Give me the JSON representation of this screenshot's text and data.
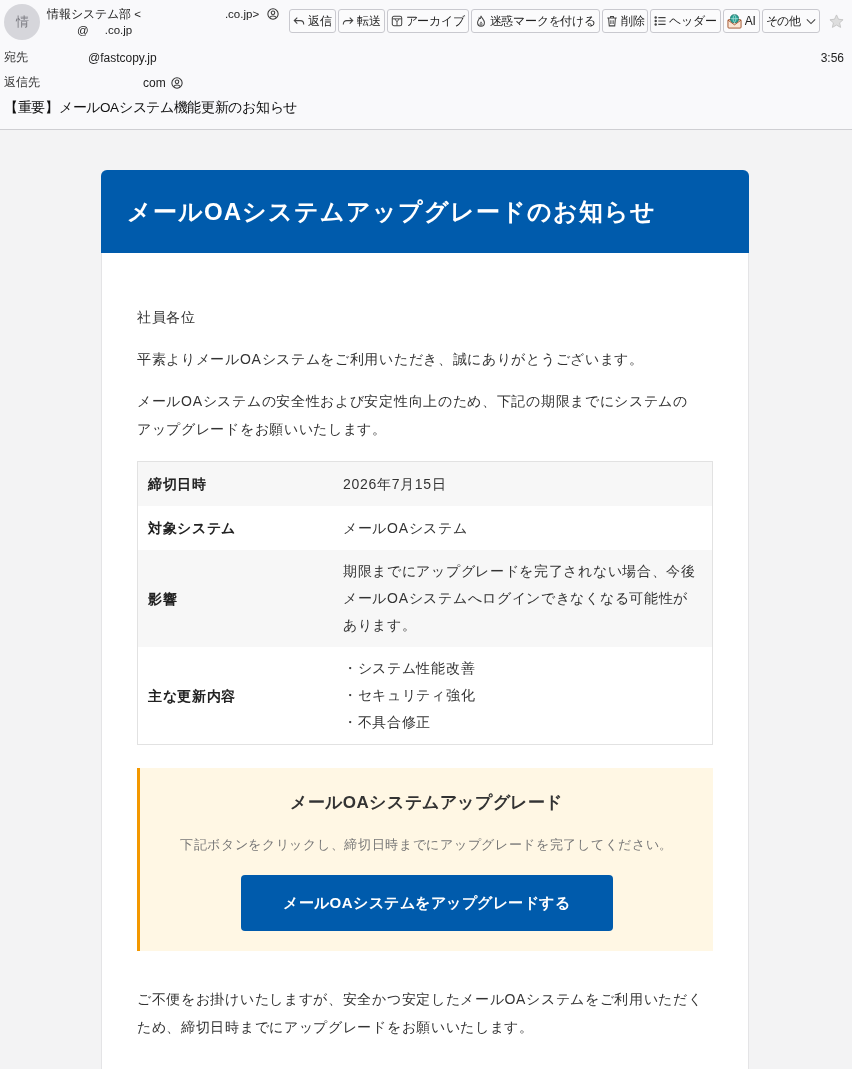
{
  "sender": {
    "avatar": "情",
    "name": "情報システム部 <",
    "address_end": ".co.jp>",
    "address_at": "@",
    "address_domain": ".co.jp"
  },
  "toolbar": [
    {
      "label": "返信",
      "kind": "action"
    },
    {
      "label": "転送",
      "kind": "action"
    },
    {
      "label": "アーカイブ",
      "kind": "action"
    },
    {
      "label": "迷惑マークを付ける",
      "kind": "action"
    },
    {
      "label": "削除",
      "kind": "action"
    },
    {
      "label": "ヘッダー",
      "kind": "action"
    },
    {
      "label": "AI",
      "kind": "action"
    },
    {
      "label": "その他",
      "kind": "menu"
    }
  ],
  "starred": false,
  "to": {
    "label": "宛先",
    "address": "@fastcopy.jp"
  },
  "time": "3:56",
  "reply_to": {
    "label": "返信先",
    "address": "com"
  },
  "subject": "【重要】メールOAシステム機能更新のお知らせ",
  "email_body": {
    "banner_title": "メールOAシステムアップグレードのお知らせ",
    "greeting": "社員各位",
    "paragraphs": [
      "平素よりメールOAシステムをご利用いただき、誠にありがとうございます。",
      "メールOAシステムの安全性および安定性向上のため、下記の期限までにシステムのアップグレードをお願いいたします。"
    ],
    "details": [
      {
        "label": "締切日時",
        "value": "2026年7月15日"
      },
      {
        "label": "対象システム",
        "value": "メールOAシステム"
      },
      {
        "label": "影響",
        "value": "期限までにアップグレードを完了されない場合、今後メールOAシステムへログインできなくなる可能性があります。"
      },
      {
        "label": "主な更新内容",
        "items": [
          "・システム性能改善",
          "・セキュリティ強化",
          "・不具合修正"
        ]
      }
    ],
    "callout": {
      "title": "メールOAシステムアップグレード",
      "text": "下記ボタンをクリックし、締切日時までにアップグレードを完了してください。",
      "button": "メールOAシステムをアップグレードする"
    },
    "closing": "ご不便をお掛けいたしますが、安全かつ安定したメールOAシステムをご利用いただくため、締切日時までにアップグレードをお願いいたします。"
  }
}
